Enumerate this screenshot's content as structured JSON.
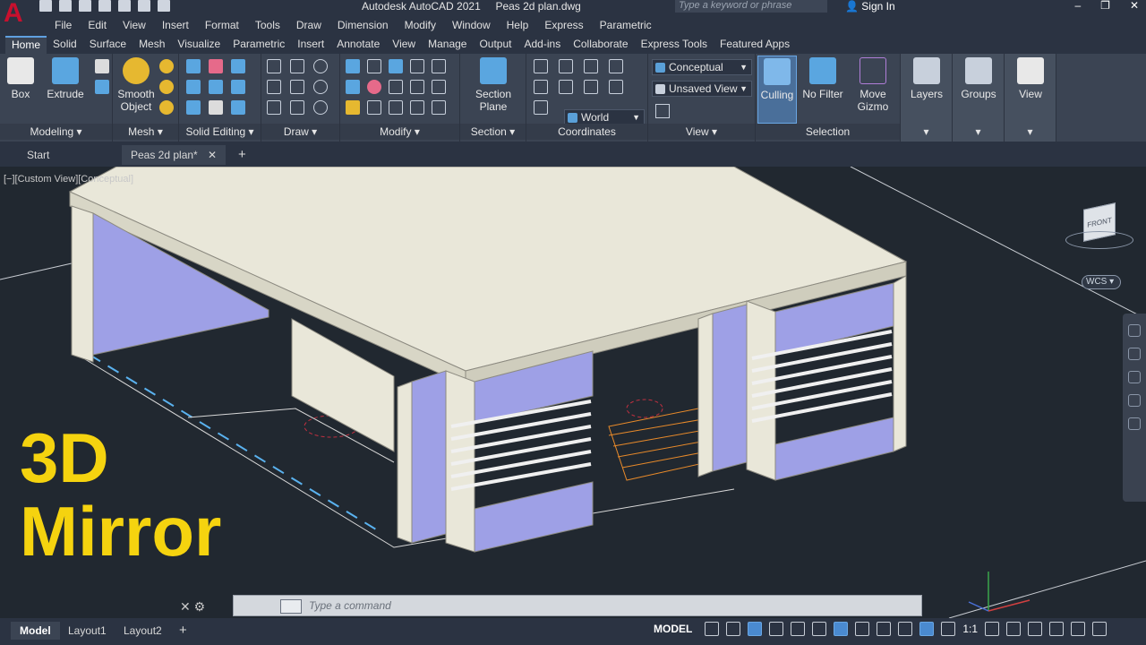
{
  "app": {
    "logo": "A",
    "title": "Autodesk AutoCAD 2021",
    "filename": "Peas 2d plan.dwg",
    "search_placeholder": "Type a keyword or phrase",
    "signin": "Sign In"
  },
  "menu": [
    "File",
    "Edit",
    "View",
    "Insert",
    "Format",
    "Tools",
    "Draw",
    "Dimension",
    "Modify",
    "Window",
    "Help",
    "Express",
    "Parametric"
  ],
  "ribbon_tabs": [
    "Home",
    "Solid",
    "Surface",
    "Mesh",
    "Visualize",
    "Parametric",
    "Insert",
    "Annotate",
    "View",
    "Manage",
    "Output",
    "Add-ins",
    "Collaborate",
    "Express Tools",
    "Featured Apps"
  ],
  "ribbon": {
    "box": "Box",
    "extrude": "Extrude",
    "smooth_object": "Smooth Object",
    "section_plane": "Section Plane",
    "culling": "Culling",
    "no_filter": "No Filter",
    "move_gizmo": "Move Gizmo",
    "layers": "Layers",
    "groups": "Groups",
    "view": "View",
    "visual_style": "Conceptual",
    "saved_view": "Unsaved View",
    "ucs": "World",
    "panel_titles": {
      "modeling": "Modeling",
      "mesh": "Mesh",
      "solid_editing": "Solid Editing",
      "draw": "Draw",
      "modify": "Modify",
      "section": "Section",
      "coordinates": "Coordinates",
      "view": "View",
      "selection": "Selection"
    }
  },
  "doc_tabs": {
    "start": "Start",
    "active": "Peas 2d plan*"
  },
  "viewport": {
    "label": "[−][Custom View][Conceptual]",
    "overlay_line1": "3D",
    "overlay_line2": "Mirror",
    "viewcube_face": "FRONT",
    "wcs": "WCS"
  },
  "command": {
    "placeholder": "Type a command"
  },
  "status": {
    "layouts": [
      "Model",
      "Layout1",
      "Layout2"
    ],
    "mode": "MODEL",
    "scale": "1:1"
  },
  "colors": {
    "overlay": "#f5d30f",
    "wall_face": "#9ea0e6",
    "slab": "#e9e7d9",
    "background": "#212830"
  }
}
